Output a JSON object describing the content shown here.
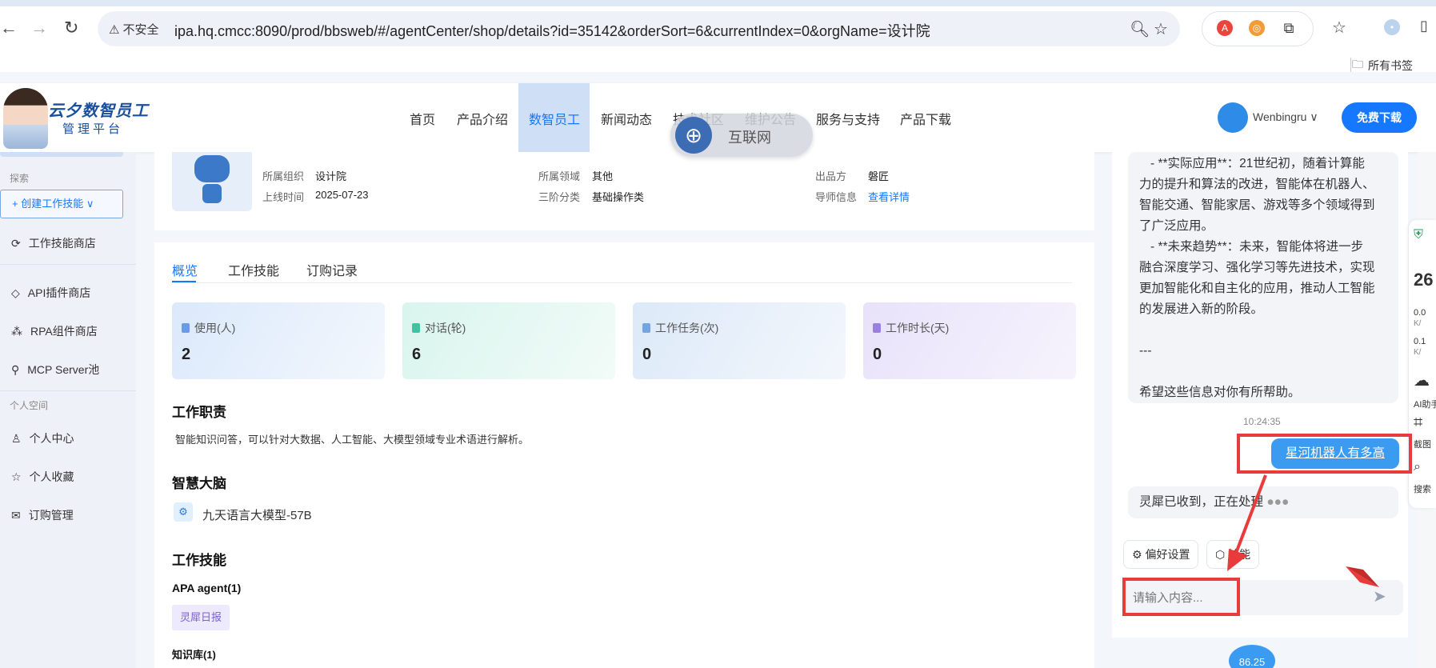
{
  "browser": {
    "security_label": "不安全",
    "url": "ipa.hq.cmcc:8090/prod/bbsweb/#/agentCenter/shop/details?id=35142&orderSort=6&currentIndex=0&orgName=设计院",
    "bookmarks_label": "所有书签"
  },
  "header": {
    "logo_title": "云夕数智员工",
    "logo_subtitle": "管理平台",
    "nav": [
      "首页",
      "产品介绍",
      "数智员工",
      "新闻动态",
      "技术社区",
      "维护公告",
      "服务与支持",
      "产品下载"
    ],
    "active_nav": "数智员工",
    "username": "Wenbingru",
    "download_label": "免费下载"
  },
  "overlay_badge": "互联网",
  "sidebar": {
    "section_explore": "探索",
    "create_label": "+ 创建工作技能 ∨",
    "items_explore": [
      "工作技能商店",
      "API插件商店",
      "RPA组件商店",
      "MCP Server池"
    ],
    "section_personal": "个人空间",
    "items_personal": [
      "个人中心",
      "个人收藏",
      "订购管理"
    ]
  },
  "details": {
    "org_label": "所属组织",
    "org_value": "设计院",
    "domain_label": "所属领域",
    "domain_value": "其他",
    "producer_label": "出品方",
    "producer_value": "磐匠",
    "online_label": "上线时间",
    "online_value": "2025-07-23",
    "category_label": "三阶分类",
    "category_value": "基础操作类",
    "mentor_label": "导师信息",
    "mentor_value": "查看详情"
  },
  "tabs": [
    "概览",
    "工作技能",
    "订购记录"
  ],
  "stats": [
    {
      "label": "使用(人)",
      "value": "2"
    },
    {
      "label": "对话(轮)",
      "value": "6"
    },
    {
      "label": "工作任务(次)",
      "value": "0"
    },
    {
      "label": "工作时长(天)",
      "value": "0"
    }
  ],
  "overview": {
    "duty_title": "工作职责",
    "duty_text": "智能知识问答，可以针对大数据、人工智能、大模型领域专业术语进行解析。",
    "brain_title": "智慧大脑",
    "brain_model": "九天语言大模型-57B",
    "skills_title": "工作技能",
    "apa_title": "APA agent(1)",
    "apa_chip": "灵犀日报",
    "kb_title": "知识库(1)"
  },
  "chat": {
    "ai_message_lines": [
      "- **实际应用**：21世纪初，随着计算能",
      "力的提升和算法的改进，智能体在机器人、",
      "智能交通、智能家居、游戏等多个领域得到",
      "了广泛应用。",
      "- **未来趋势**：未来，智能体将进一步",
      "融合深度学习、强化学习等先进技术，实现",
      "更加智能化和自主化的应用，推动人工智能",
      "的发展进入新的阶段。",
      "",
      "---",
      "",
      "希望这些信息对你有所帮助。"
    ],
    "time": "10:24:35",
    "user_message": "星河机器人有多高",
    "processing_text": "灵犀已收到，正在处理",
    "pref_button": "偏好设置",
    "skill_button": "技能",
    "input_placeholder": "请输入内容...",
    "bottom_badge": "86.25"
  },
  "mini_sidebar": {
    "number": "26",
    "speed1": "0.0",
    "speed2": "0.1",
    "unit": "K/",
    "ai_label": "AI助手",
    "screenshot_label": "截图",
    "search_label": "搜索"
  },
  "colors": {
    "primary": "#1677ff",
    "annotation_red": "#e83b3b"
  }
}
